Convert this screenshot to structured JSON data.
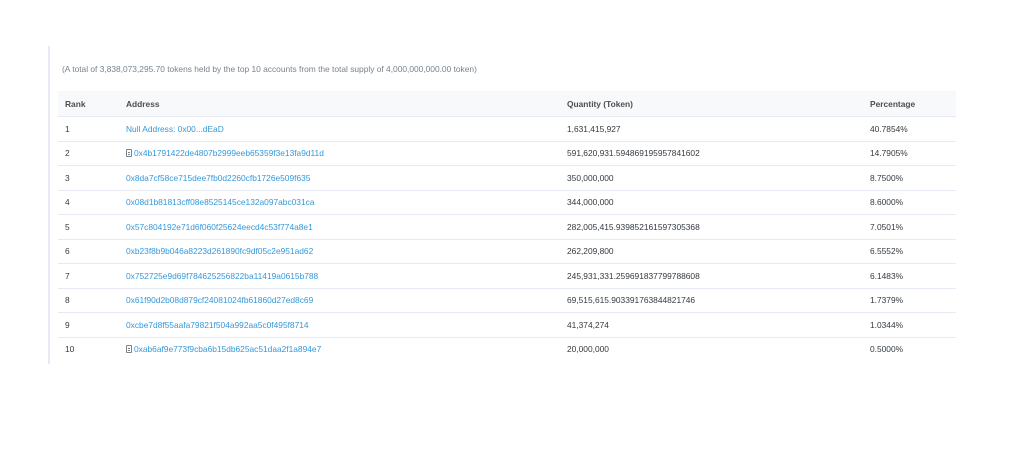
{
  "summary": "(A total of 3,838,073,295.70 tokens held by the top 10 accounts from the total supply of 4,000,000,000.00 token)",
  "table": {
    "headers": {
      "rank": "Rank",
      "address": "Address",
      "quantity": "Quantity (Token)",
      "percentage": "Percentage"
    },
    "rows": [
      {
        "rank": "1",
        "address": "Null Address: 0x00...dEaD",
        "contract": false,
        "quantity": "1,631,415,927",
        "percentage": "40.7854%"
      },
      {
        "rank": "2",
        "address": "0x4b1791422de4807b2999eeb65359f3e13fa9d11d",
        "contract": true,
        "quantity": "591,620,931.594869195957841602",
        "percentage": "14.7905%"
      },
      {
        "rank": "3",
        "address": "0x8da7cf58ce715dee7fb0d2260cfb1726e509f635",
        "contract": false,
        "quantity": "350,000,000",
        "percentage": "8.7500%"
      },
      {
        "rank": "4",
        "address": "0x08d1b81813cff08e8525145ce132a097abc031ca",
        "contract": false,
        "quantity": "344,000,000",
        "percentage": "8.6000%"
      },
      {
        "rank": "5",
        "address": "0x57c804192e71d6f060f25624eecd4c53f774a8e1",
        "contract": false,
        "quantity": "282,005,415.939852161597305368",
        "percentage": "7.0501%"
      },
      {
        "rank": "6",
        "address": "0xb23f8b9b046a8223d261890fc9df05c2e951ad62",
        "contract": false,
        "quantity": "262,209,800",
        "percentage": "6.5552%"
      },
      {
        "rank": "7",
        "address": "0x752725e9d69f784625256822ba11419a0615b788",
        "contract": false,
        "quantity": "245,931,331.259691837799788608",
        "percentage": "6.1483%"
      },
      {
        "rank": "8",
        "address": "0x61f90d2b08d879cf24081024fb61860d27ed8c69",
        "contract": false,
        "quantity": "69,515,615.903391763844821746",
        "percentage": "1.7379%"
      },
      {
        "rank": "9",
        "address": "0xcbe7d8f55aafa79821f504a992aa5c0f495f8714",
        "contract": false,
        "quantity": "41,374,274",
        "percentage": "1.0344%"
      },
      {
        "rank": "10",
        "address": "0xab6af9e773f9cba6b15db625ac51daa2f1a894e7",
        "contract": true,
        "quantity": "20,000,000",
        "percentage": "0.5000%"
      }
    ]
  },
  "colors": {
    "link": "#3498db",
    "header_bg": "#f8f9fa",
    "border": "#e7eaf3",
    "muted_text": "#77838f"
  },
  "icons": {
    "contract": "contract-document-icon"
  }
}
